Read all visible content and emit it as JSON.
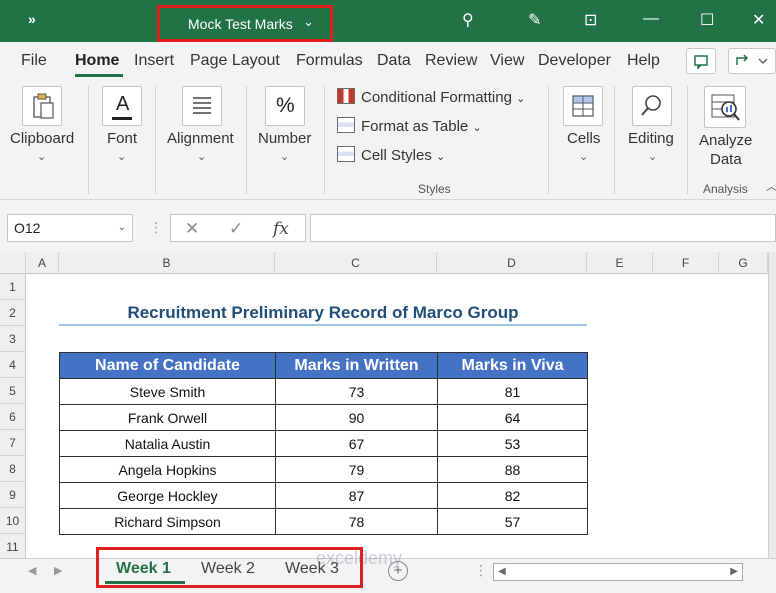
{
  "titlebar": {
    "quick_access": "»",
    "document_title": "Mock Test Marks",
    "title_dropdown": "⌄",
    "search_icon": "⚲",
    "pen_icon": "✎",
    "present_icon": "⊡",
    "minimize": "—",
    "maximize": "☐",
    "close": "✕"
  },
  "ribbon_tabs": [
    "File",
    "Home",
    "Insert",
    "Page Layout",
    "Formulas",
    "Data",
    "Review",
    "View",
    "Developer",
    "Help"
  ],
  "ribbon": {
    "clipboard": "Clipboard",
    "font": "Font",
    "alignment": "Alignment",
    "number": "Number",
    "number_icon": "%",
    "font_icon": "A",
    "conditional_formatting": "Conditional Formatting",
    "format_as_table": "Format as Table",
    "cell_styles": "Cell Styles",
    "styles_group": "Styles",
    "cells": "Cells",
    "editing": "Editing",
    "analyze_data_line1": "Analyze",
    "analyze_data_line2": "Data",
    "analysis_group": "Analysis",
    "dropdown": "⌄"
  },
  "formula_bar": {
    "name_box": "O12",
    "cancel": "✕",
    "enter": "✓",
    "fx": "fx",
    "formula": ""
  },
  "columns": [
    "A",
    "B",
    "C",
    "D",
    "E",
    "F",
    "G"
  ],
  "rows": [
    "1",
    "2",
    "3",
    "4",
    "5",
    "6",
    "7",
    "8",
    "9",
    "10",
    "11"
  ],
  "sheet": {
    "title": "Recruitment Preliminary Record of Marco Group",
    "headers": [
      "Name of Candidate",
      "Marks in Written",
      "Marks in Viva"
    ],
    "records": [
      [
        "Steve Smith",
        "73",
        "81"
      ],
      [
        "Frank Orwell",
        "90",
        "64"
      ],
      [
        "Natalia Austin",
        "67",
        "53"
      ],
      [
        "Angela Hopkins",
        "79",
        "88"
      ],
      [
        "George Hockley",
        "87",
        "82"
      ],
      [
        "Richard Simpson",
        "78",
        "57"
      ]
    ]
  },
  "sheet_tabs": [
    "Week 1",
    "Week 2",
    "Week 3"
  ],
  "add_sheet": "+",
  "watermark": "exceldemy",
  "colors": {
    "excel_green": "#217346",
    "header_blue": "#4472c4",
    "title_blue": "#1f4e79",
    "highlight_red": "#e02020"
  }
}
